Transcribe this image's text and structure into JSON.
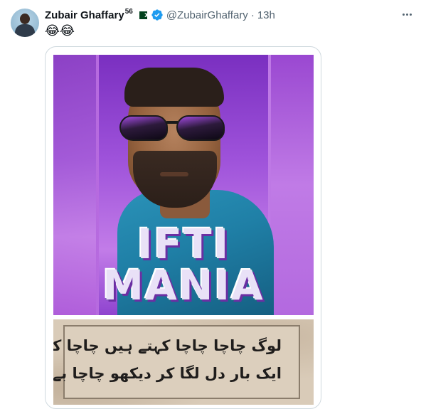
{
  "tweet": {
    "author": {
      "name": "Zubair Ghaffary",
      "superscript": "56",
      "handle": "@ZubairGhaffary",
      "separator": "·",
      "time": "13h"
    },
    "text": "😂😂",
    "media": {
      "poster": {
        "line1": "IFTI",
        "line2": "MANIA"
      },
      "signboard": {
        "line1": "لوگ چاچا چاچا کہتے ہیں چاچا کو پرواہ نہیں",
        "line2": "ایک بار دل لگا کر دیکھو چاچا بے وفا نہیں"
      }
    },
    "icons": {
      "flag": "pakistan-flag-icon",
      "verified": "verified-badge-icon",
      "more": "more-options-icon"
    },
    "colors": {
      "verified": "#1d9bf0",
      "secondary_text": "#536471",
      "border": "#cfd9de"
    }
  }
}
